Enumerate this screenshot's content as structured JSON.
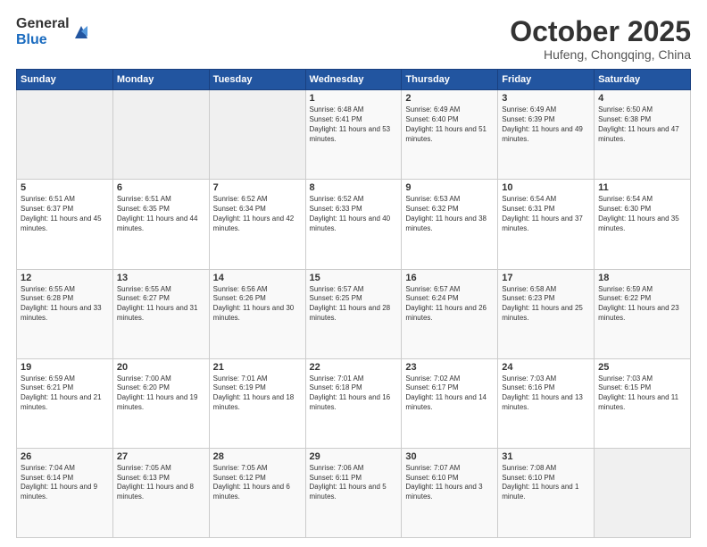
{
  "logo": {
    "general": "General",
    "blue": "Blue"
  },
  "header": {
    "month": "October 2025",
    "location": "Hufeng, Chongqing, China"
  },
  "days_of_week": [
    "Sunday",
    "Monday",
    "Tuesday",
    "Wednesday",
    "Thursday",
    "Friday",
    "Saturday"
  ],
  "weeks": [
    [
      {
        "day": "",
        "content": ""
      },
      {
        "day": "",
        "content": ""
      },
      {
        "day": "",
        "content": ""
      },
      {
        "day": "1",
        "content": "Sunrise: 6:48 AM\nSunset: 6:41 PM\nDaylight: 11 hours and 53 minutes."
      },
      {
        "day": "2",
        "content": "Sunrise: 6:49 AM\nSunset: 6:40 PM\nDaylight: 11 hours and 51 minutes."
      },
      {
        "day": "3",
        "content": "Sunrise: 6:49 AM\nSunset: 6:39 PM\nDaylight: 11 hours and 49 minutes."
      },
      {
        "day": "4",
        "content": "Sunrise: 6:50 AM\nSunset: 6:38 PM\nDaylight: 11 hours and 47 minutes."
      }
    ],
    [
      {
        "day": "5",
        "content": "Sunrise: 6:51 AM\nSunset: 6:37 PM\nDaylight: 11 hours and 45 minutes."
      },
      {
        "day": "6",
        "content": "Sunrise: 6:51 AM\nSunset: 6:35 PM\nDaylight: 11 hours and 44 minutes."
      },
      {
        "day": "7",
        "content": "Sunrise: 6:52 AM\nSunset: 6:34 PM\nDaylight: 11 hours and 42 minutes."
      },
      {
        "day": "8",
        "content": "Sunrise: 6:52 AM\nSunset: 6:33 PM\nDaylight: 11 hours and 40 minutes."
      },
      {
        "day": "9",
        "content": "Sunrise: 6:53 AM\nSunset: 6:32 PM\nDaylight: 11 hours and 38 minutes."
      },
      {
        "day": "10",
        "content": "Sunrise: 6:54 AM\nSunset: 6:31 PM\nDaylight: 11 hours and 37 minutes."
      },
      {
        "day": "11",
        "content": "Sunrise: 6:54 AM\nSunset: 6:30 PM\nDaylight: 11 hours and 35 minutes."
      }
    ],
    [
      {
        "day": "12",
        "content": "Sunrise: 6:55 AM\nSunset: 6:28 PM\nDaylight: 11 hours and 33 minutes."
      },
      {
        "day": "13",
        "content": "Sunrise: 6:55 AM\nSunset: 6:27 PM\nDaylight: 11 hours and 31 minutes."
      },
      {
        "day": "14",
        "content": "Sunrise: 6:56 AM\nSunset: 6:26 PM\nDaylight: 11 hours and 30 minutes."
      },
      {
        "day": "15",
        "content": "Sunrise: 6:57 AM\nSunset: 6:25 PM\nDaylight: 11 hours and 28 minutes."
      },
      {
        "day": "16",
        "content": "Sunrise: 6:57 AM\nSunset: 6:24 PM\nDaylight: 11 hours and 26 minutes."
      },
      {
        "day": "17",
        "content": "Sunrise: 6:58 AM\nSunset: 6:23 PM\nDaylight: 11 hours and 25 minutes."
      },
      {
        "day": "18",
        "content": "Sunrise: 6:59 AM\nSunset: 6:22 PM\nDaylight: 11 hours and 23 minutes."
      }
    ],
    [
      {
        "day": "19",
        "content": "Sunrise: 6:59 AM\nSunset: 6:21 PM\nDaylight: 11 hours and 21 minutes."
      },
      {
        "day": "20",
        "content": "Sunrise: 7:00 AM\nSunset: 6:20 PM\nDaylight: 11 hours and 19 minutes."
      },
      {
        "day": "21",
        "content": "Sunrise: 7:01 AM\nSunset: 6:19 PM\nDaylight: 11 hours and 18 minutes."
      },
      {
        "day": "22",
        "content": "Sunrise: 7:01 AM\nSunset: 6:18 PM\nDaylight: 11 hours and 16 minutes."
      },
      {
        "day": "23",
        "content": "Sunrise: 7:02 AM\nSunset: 6:17 PM\nDaylight: 11 hours and 14 minutes."
      },
      {
        "day": "24",
        "content": "Sunrise: 7:03 AM\nSunset: 6:16 PM\nDaylight: 11 hours and 13 minutes."
      },
      {
        "day": "25",
        "content": "Sunrise: 7:03 AM\nSunset: 6:15 PM\nDaylight: 11 hours and 11 minutes."
      }
    ],
    [
      {
        "day": "26",
        "content": "Sunrise: 7:04 AM\nSunset: 6:14 PM\nDaylight: 11 hours and 9 minutes."
      },
      {
        "day": "27",
        "content": "Sunrise: 7:05 AM\nSunset: 6:13 PM\nDaylight: 11 hours and 8 minutes."
      },
      {
        "day": "28",
        "content": "Sunrise: 7:05 AM\nSunset: 6:12 PM\nDaylight: 11 hours and 6 minutes."
      },
      {
        "day": "29",
        "content": "Sunrise: 7:06 AM\nSunset: 6:11 PM\nDaylight: 11 hours and 5 minutes."
      },
      {
        "day": "30",
        "content": "Sunrise: 7:07 AM\nSunset: 6:10 PM\nDaylight: 11 hours and 3 minutes."
      },
      {
        "day": "31",
        "content": "Sunrise: 7:08 AM\nSunset: 6:10 PM\nDaylight: 11 hours and 1 minute."
      },
      {
        "day": "",
        "content": ""
      }
    ]
  ]
}
